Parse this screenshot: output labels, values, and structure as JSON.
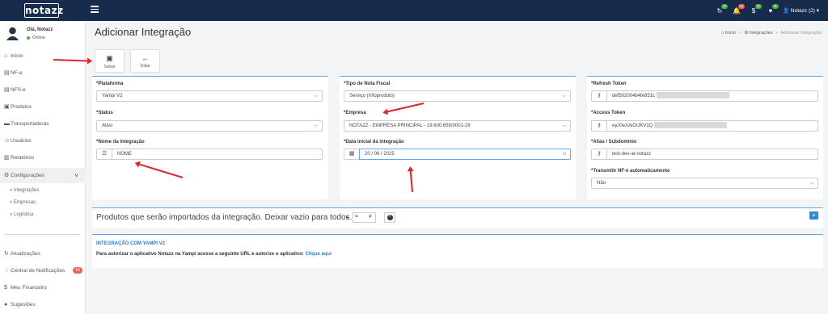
{
  "topbar": {
    "logo": "notazz",
    "badges": [
      {
        "icon": "sync-icon",
        "count": "0",
        "color": "#4caf50"
      },
      {
        "icon": "bell-icon",
        "count": "14",
        "color": "#f06352"
      },
      {
        "icon": "dollar-icon",
        "count": "0",
        "color": "#4caf50"
      },
      {
        "icon": "heart-icon",
        "count": "0",
        "color": "#4caf50"
      }
    ],
    "user_menu": "Notazz (2)"
  },
  "sidebar": {
    "greeting": "Olá, Notazz",
    "status": "Online",
    "items": [
      {
        "label": "Início",
        "icon": "home-icon"
      },
      {
        "label": "NF-e",
        "icon": "file-icon"
      },
      {
        "label": "NFS-e",
        "icon": "file-icon"
      },
      {
        "label": "Produtos",
        "icon": "box-icon"
      },
      {
        "label": "Transportadoras",
        "icon": "truck-icon"
      },
      {
        "label": "Usuários",
        "icon": "user-icon"
      },
      {
        "label": "Relatórios",
        "icon": "chart-icon"
      },
      {
        "label": "Configurações",
        "icon": "gear-icon"
      }
    ],
    "subitems": [
      {
        "label": "Integrações"
      },
      {
        "label": "Empresas"
      },
      {
        "label": "Logística"
      }
    ],
    "bottom_items": [
      {
        "label": "Atualizações",
        "icon": "refresh-icon"
      },
      {
        "label": "Central de Notificações",
        "icon": "bell-icon",
        "badge": "14"
      },
      {
        "label": "Meu Financeiro",
        "icon": "dollar-icon"
      },
      {
        "label": "Sugestões",
        "icon": "bulb-icon"
      }
    ]
  },
  "page": {
    "title": "Adicionar Integração",
    "breadcrumb": [
      "Início",
      "Integrações",
      "Adicionar Integração"
    ]
  },
  "actions": {
    "save": "Salvar",
    "back": "Voltar"
  },
  "form": {
    "platform_label": "*Plataforma",
    "platform_value": "Yampi V2",
    "status_label": "*Status",
    "status_value": "Ativo",
    "name_label": "*Nome da Integração",
    "name_value": "NOME",
    "fiscal_type_label": "*Tipo de Nota Fiscal",
    "fiscal_type_value": "Serviço (Infoproduto)",
    "company_label": "*Empresa",
    "company_value": "NOTAZZ - EMPRESA PRINCIPAL - 19.600.655/0001-29",
    "start_date_label": "*Data inicial da integração",
    "start_date_value": "20 / 06 / 2025",
    "refresh_token_label": "*Refresh Token",
    "refresh_token_value": "def502004b4fe851c",
    "access_token_label": "*Access Token",
    "access_token_value": "eyJ0eXAiOiJKV1Q",
    "alias_label": "*Alias / Subdomínio",
    "alias_value": "test-dev-at-notazz",
    "transmit_label": "*Transmitir NF-e automaticamente",
    "transmit_value": "Não"
  },
  "products": {
    "title": "Produtos que serão importados da integração. Deixar vazio para todos.",
    "equal": "=",
    "not_equal": "≠",
    "help": "?",
    "add": "+"
  },
  "integration_info": {
    "title": "INTEGRAÇÃO COM YAMPI V2",
    "text": "Para autorizar o aplicativo Notazz na Yampi acesse a seguinte URL e autorize o aplicativo: ",
    "link": "Clique aqui"
  },
  "colors": {
    "topbar": "#172b4d",
    "accent": "#5ea8dd",
    "arrow": "#e0242a",
    "link": "#2b7fc7"
  }
}
